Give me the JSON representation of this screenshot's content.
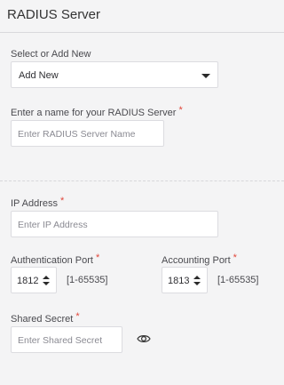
{
  "header": {
    "title": "RADIUS Server"
  },
  "select_server": {
    "label": "Select or Add New",
    "value": "Add New"
  },
  "server_name": {
    "label": "Enter a name for your RADIUS Server",
    "required_mark": "*",
    "placeholder": "Enter RADIUS Server Name"
  },
  "ip_address": {
    "label": "IP Address",
    "required_mark": "*",
    "placeholder": "Enter IP Address"
  },
  "auth_port": {
    "label": "Authentication Port",
    "required_mark": "*",
    "value": "1812",
    "range": "[1-65535]"
  },
  "acct_port": {
    "label": "Accounting Port",
    "required_mark": "*",
    "value": "1813",
    "range": "[1-65535]"
  },
  "shared_secret": {
    "label": "Shared Secret",
    "required_mark": "*",
    "placeholder": "Enter Shared Secret",
    "toggle_icon": "eye-icon"
  },
  "colors": {
    "background": "#f4f4f5",
    "required": "#e0463a",
    "input_border": "#dcdce0"
  }
}
